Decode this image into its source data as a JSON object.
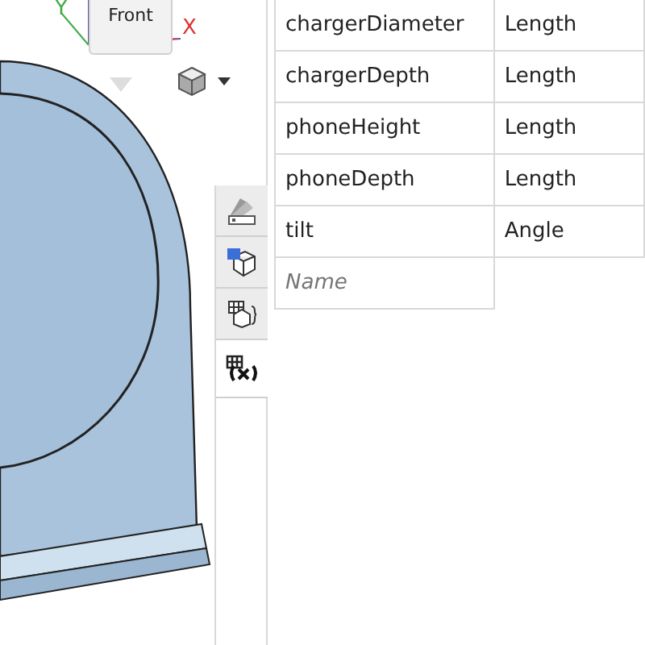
{
  "viewport": {
    "view_cube_label": "Front",
    "x_axis": "X",
    "y_axis": "Y"
  },
  "side_tabs": [
    {
      "kind": "appearance",
      "selected": false
    },
    {
      "kind": "parts",
      "selected": false
    },
    {
      "kind": "configurations",
      "selected": false
    },
    {
      "kind": "variables",
      "selected": true
    }
  ],
  "table": {
    "rows": [
      {
        "name": "chargerDiameter",
        "type": "Length"
      },
      {
        "name": "chargerDepth",
        "type": "Length"
      },
      {
        "name": "phoneHeight",
        "type": "Length"
      },
      {
        "name": "phoneDepth",
        "type": "Length"
      },
      {
        "name": "tilt",
        "type": "Angle"
      }
    ],
    "new_row": {
      "placeholder": "Name"
    }
  }
}
